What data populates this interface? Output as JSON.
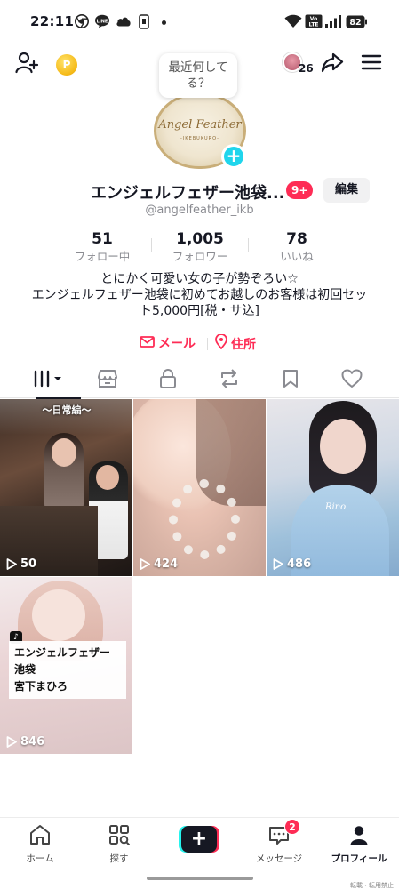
{
  "status_bar": {
    "time": "22:11",
    "icons": [
      "chrome-icon",
      "line-icon",
      "cloud-icon",
      "phone-sync-icon",
      "wifi-icon",
      "volte-icon",
      "signal-icon",
      "battery-icon"
    ],
    "volte_label": "Vo LTE",
    "battery": "82"
  },
  "top_nav": {
    "add_friend_icon": "person-add-icon",
    "coin_icon": "coin-icon",
    "coin_glyph": "P",
    "friends_count": "26",
    "share_icon": "share-arrow-icon",
    "menu_icon": "hamburger-menu-icon"
  },
  "profile": {
    "note": "最近何してる？",
    "avatar_text_main": "Angel Feather",
    "avatar_text_sub": "-IKEBUKURO-",
    "name": "エンジェルフェザー池袋...",
    "notification_badge": "9+",
    "edit_label": "編集",
    "handle": "@angelfeather_ikb",
    "stats": [
      {
        "value": "51",
        "label": "フォロー中"
      },
      {
        "value": "1,005",
        "label": "フォロワー"
      },
      {
        "value": "78",
        "label": "いいね"
      }
    ],
    "bio": "とにかく可愛い女の子が勢ぞろい☆\nエンジェルフェザー池袋に初めてお越しのお客様は初回セット5,000円[税・サ込]",
    "links": {
      "mail": "メール",
      "address": "住所"
    }
  },
  "tabs": [
    "videos-grid-icon",
    "shop-icon",
    "lock-icon",
    "repost-icon",
    "bookmark-icon",
    "heart-icon"
  ],
  "videos": [
    {
      "views": "50",
      "overlay_text": "〜日常編〜"
    },
    {
      "views": "424"
    },
    {
      "views": "486",
      "overlay_text": "Rino"
    },
    {
      "views": "846",
      "caption": [
        "エンジェルフェザー",
        "池袋",
        "宮下まひろ"
      ]
    }
  ],
  "bottom_nav": {
    "home": "ホーム",
    "discover": "探す",
    "create": "+",
    "inbox": "メッセージ",
    "inbox_badge": "2",
    "profile": "プロフィール"
  },
  "watermark": "転載・転用禁止",
  "colors": {
    "accent": "#fe2c55",
    "cyan": "#25f4ee",
    "text": "#161823",
    "muted": "#8a8b91"
  }
}
